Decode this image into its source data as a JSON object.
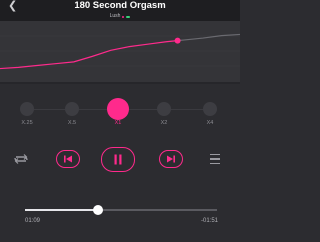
{
  "header": {
    "title": "180 Second Orgasm",
    "subtitle": "Lush",
    "back_icon": "chevron-left-icon"
  },
  "colors": {
    "accent": "#ff2a8c",
    "background": "#2c2c30",
    "graph_background": "#343438"
  },
  "graph": {
    "series": [
      0.22,
      0.24,
      0.27,
      0.3,
      0.33,
      0.42,
      0.52,
      0.58,
      0.62,
      0.66,
      0.69,
      0.72,
      0.76,
      0.78
    ],
    "played_fraction": 0.74
  },
  "speed": {
    "options": [
      "X.25",
      "X.5",
      "X1",
      "X2",
      "X4"
    ],
    "selected_index": 2
  },
  "controls": {
    "repeat_icon": "repeat-icon",
    "prev_icon": "skip-previous-icon",
    "play_icon": "pause-icon",
    "next_icon": "skip-next-icon",
    "menu_icon": "menu-icon"
  },
  "playback": {
    "elapsed": "01:09",
    "remaining": "-01:51",
    "progress": 0.38
  }
}
